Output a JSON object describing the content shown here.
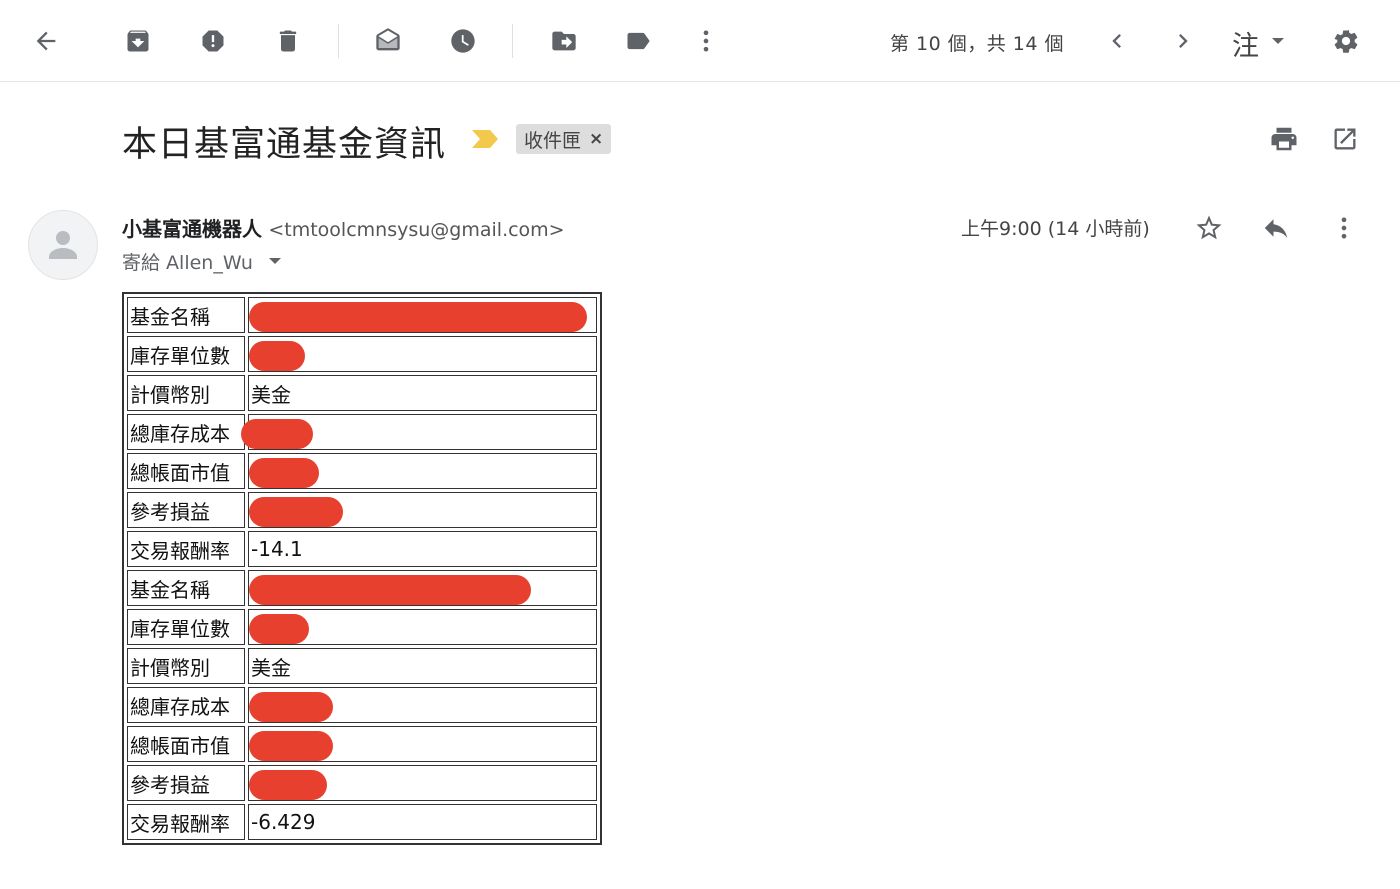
{
  "toolbar": {
    "pager": "第 10 個，共 14 個",
    "lang": "注",
    "icons": [
      "back-arrow-icon",
      "archive-icon",
      "report-spam-icon",
      "delete-icon",
      "mark-unread-icon",
      "snooze-icon",
      "move-to-icon",
      "labels-icon",
      "more-vert-icon",
      "prev-icon",
      "next-icon",
      "settings-icon"
    ]
  },
  "message": {
    "subject": "本日基富通基金資訊",
    "label": "收件匣",
    "label_close": "×",
    "sender_name": "小基富通機器人",
    "sender_email": "<tmtoolcmnsysu@gmail.com>",
    "to": "寄給 Allen_Wu",
    "time": "上午9:00 (14 小時前)"
  },
  "table": {
    "rows": [
      {
        "key": "基金名稱",
        "value": "",
        "redacted": true
      },
      {
        "key": "庫存單位數",
        "value": "",
        "redacted": true
      },
      {
        "key": "計價幣別",
        "value": "美金",
        "redacted": false
      },
      {
        "key": "總庫存成本",
        "value": "",
        "redacted": true
      },
      {
        "key": "總帳面市值",
        "value": "",
        "redacted": true
      },
      {
        "key": "參考損益",
        "value": "",
        "redacted": true
      },
      {
        "key": "交易報酬率",
        "value": "-14.1",
        "redacted": false,
        "green": true
      },
      {
        "key": "基金名稱",
        "value": "",
        "redacted": true
      },
      {
        "key": "庫存單位數",
        "value": "",
        "redacted": true
      },
      {
        "key": "計價幣別",
        "value": "美金",
        "redacted": false
      },
      {
        "key": "總庫存成本",
        "value": "",
        "redacted": true
      },
      {
        "key": "總帳面市值",
        "value": "",
        "redacted": true
      },
      {
        "key": "參考損益",
        "value": "",
        "redacted": true
      },
      {
        "key": "交易報酬率",
        "value": "-6.429",
        "redacted": false,
        "green": true
      }
    ]
  },
  "colors": {
    "redaction": "#e8402f",
    "positive_green": "#2e7d1a",
    "icon_gray": "#5f6368"
  }
}
